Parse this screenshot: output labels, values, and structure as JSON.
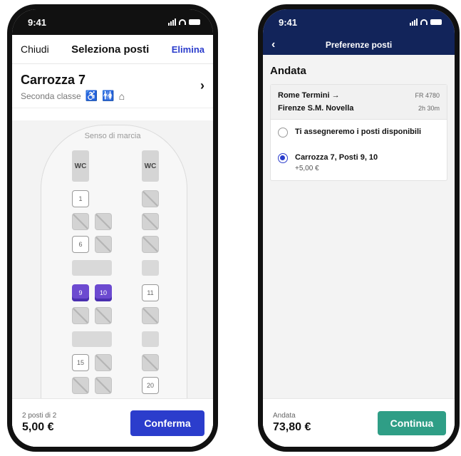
{
  "left": {
    "status_time": "9:41",
    "nav": {
      "close": "Chiudi",
      "title": "Seleziona posti",
      "delete": "Elimina"
    },
    "coach": {
      "name": "Carrozza 7",
      "class": "Seconda classe",
      "icons": [
        "wheelchair-icon",
        "toilet-icon",
        "luggage-icon"
      ]
    },
    "direction": "Senso di marcia",
    "wc_label": "WC",
    "seats": {
      "s1": "1",
      "s6": "6",
      "s9": "9",
      "s10": "10",
      "s11": "11",
      "s15": "15",
      "s20": "20"
    },
    "footer": {
      "count": "2 posti di 2",
      "price": "5,00 €",
      "confirm": "Conferma"
    }
  },
  "right": {
    "status_time": "9:41",
    "nav": {
      "title": "Preferenze posti"
    },
    "section": "Andata",
    "route": {
      "from": "Rome Termini →",
      "to": "Firenze S.M. Novella",
      "train": "FR 4780",
      "duration": "2h 30m"
    },
    "options": [
      {
        "label": "Ti assegneremo i posti disponibili",
        "sub": ""
      },
      {
        "label": "Carrozza 7, Posti 9, 10",
        "sub": "+5,00 €"
      }
    ],
    "footer": {
      "label": "Andata",
      "price": "73,80 €",
      "continue": "Continua"
    }
  },
  "colors": {
    "primary": "#2b3dcc",
    "navy": "#12245a",
    "selected_seat": "#6c4ad0",
    "continue": "#2f9e86"
  }
}
